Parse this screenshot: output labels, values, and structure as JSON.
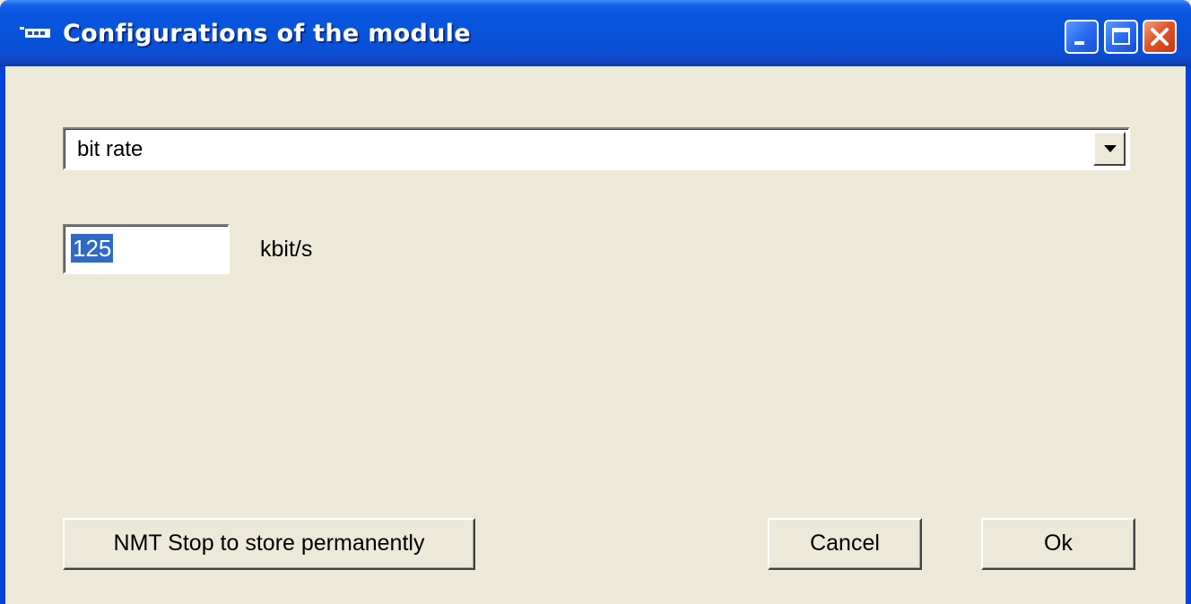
{
  "window": {
    "title": "Configurations of the module",
    "icon": "application-icon",
    "controls": {
      "minimize": "minimize-icon",
      "maximize": "maximize-icon",
      "close": "close-icon"
    }
  },
  "parameter_select": {
    "selected": "bit rate",
    "dropdown_icon": "chevron-down-icon"
  },
  "bit_rate": {
    "value": "125",
    "unit": "kbit/s"
  },
  "buttons": {
    "nmt_stop": "NMT Stop to store permanently",
    "cancel": "Cancel",
    "ok": "Ok"
  },
  "colors": {
    "titlebar": "#0a55e0",
    "client_background": "#ece9d8",
    "selection_highlight": "#316ac5",
    "close_button": "#e0552a"
  }
}
